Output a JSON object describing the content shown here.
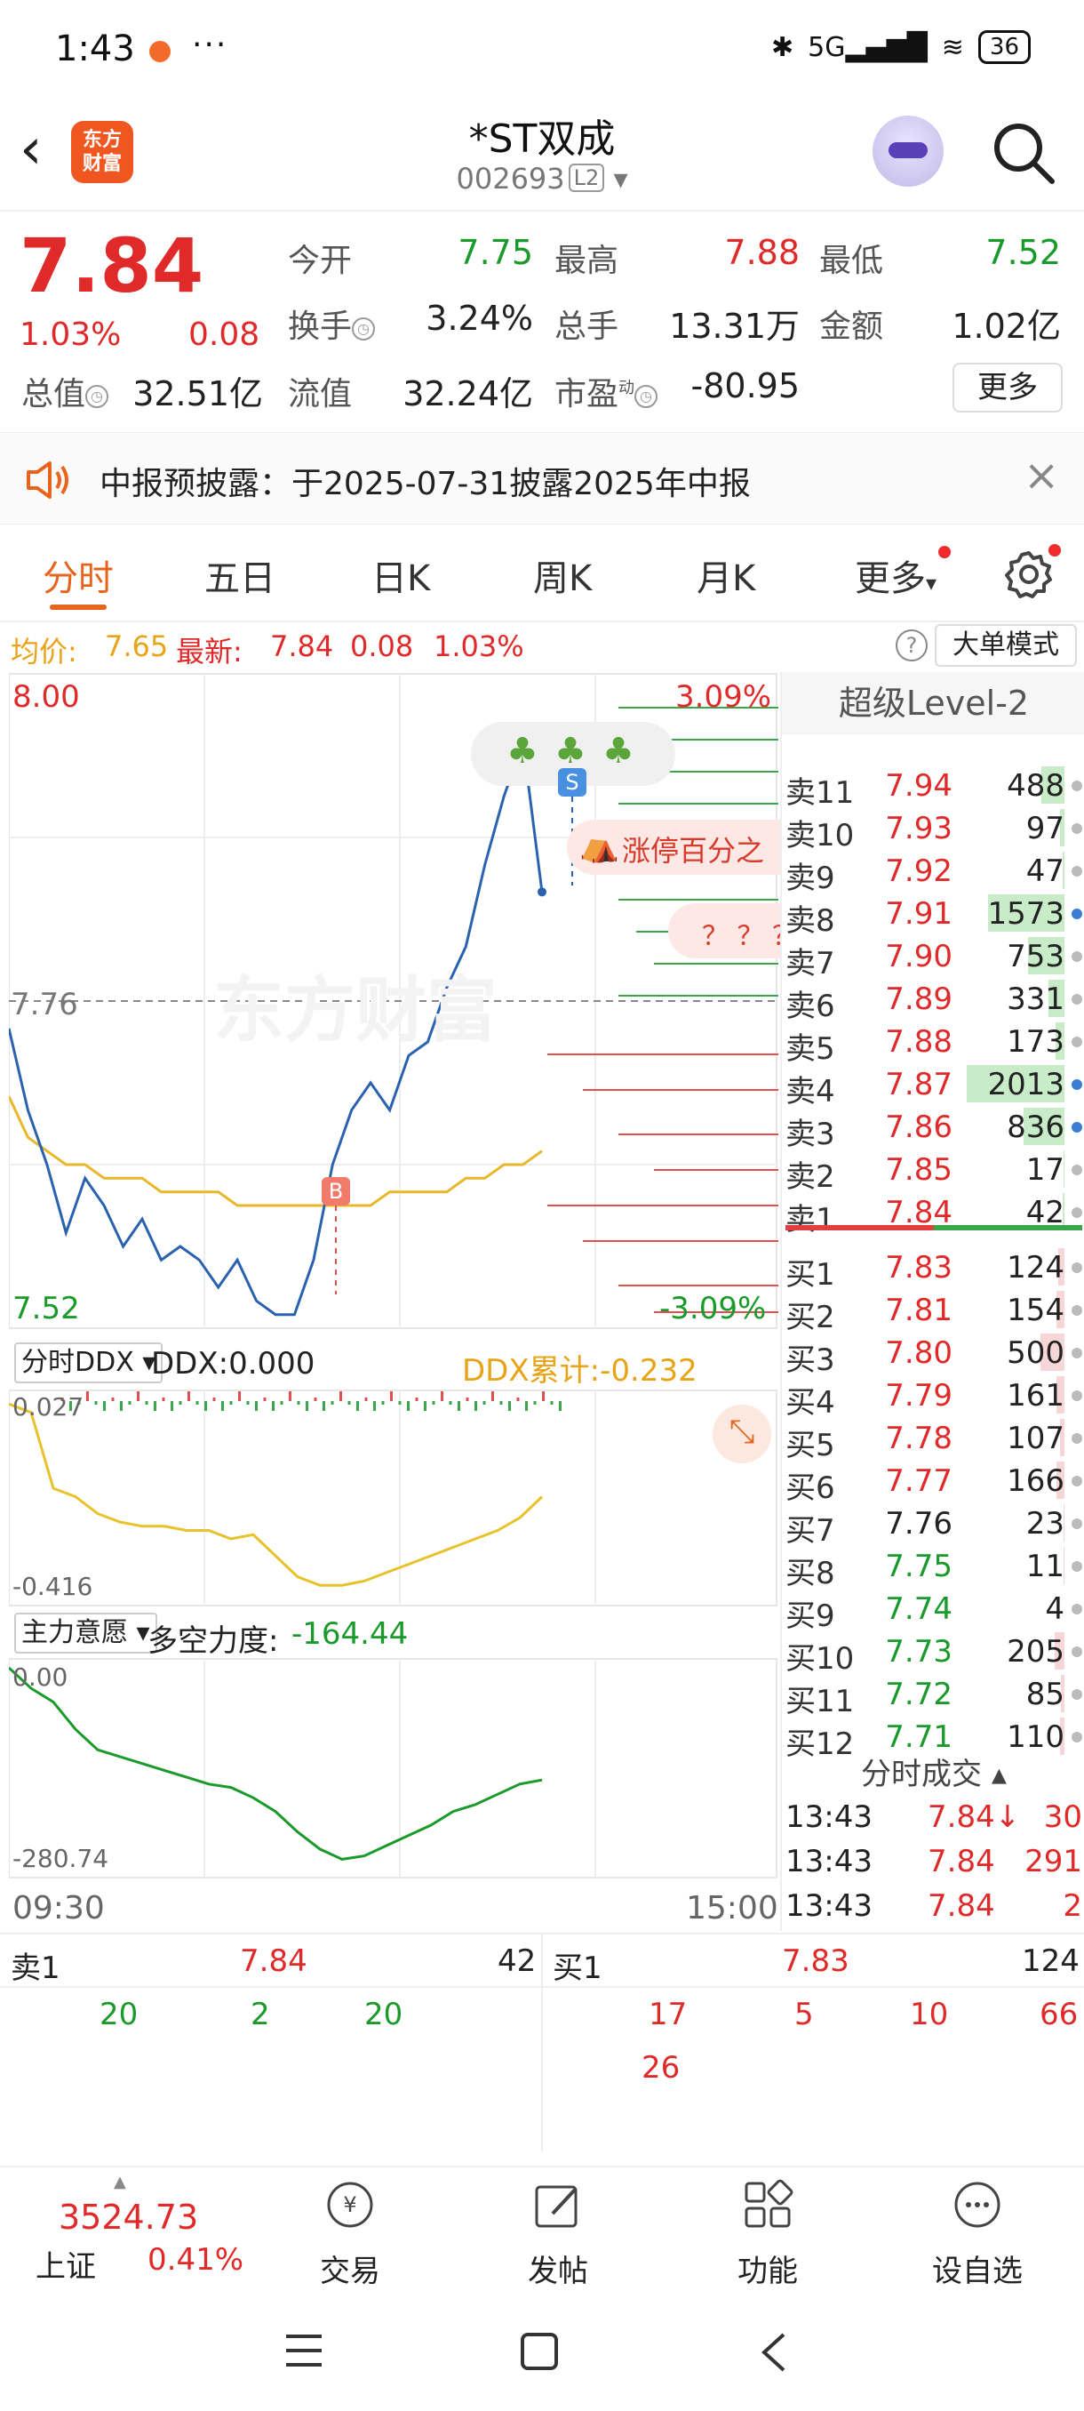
{
  "status_bar": {
    "time": "1:43",
    "more": "···",
    "network": "5G",
    "battery": "36"
  },
  "header": {
    "logo_line1": "东方",
    "logo_line2": "财富",
    "name": "*ST双成",
    "code": "002693",
    "level": "L2"
  },
  "quote": {
    "price": "7.84",
    "change_pct": "1.03%",
    "change_amt": "0.08",
    "open_label": "今开",
    "open": "7.75",
    "high_label": "最高",
    "high": "7.88",
    "low_label": "最低",
    "low": "7.52",
    "turnover_label": "换手",
    "turnover": "3.24%",
    "volume_label": "总手",
    "volume": "13.31万",
    "amount_label": "金额",
    "amount": "1.02亿",
    "mktcap_label": "总值",
    "mktcap": "32.51亿",
    "float_label": "流值",
    "float": "32.24亿",
    "pe_label": "市盈",
    "pe_sup": "动",
    "pe": "-80.95",
    "more_label": "更多"
  },
  "notice": {
    "text": "中报预披露：于2025-07-31披露2025年中报"
  },
  "tabs": [
    {
      "label": "分时"
    },
    {
      "label": "五日"
    },
    {
      "label": "日K"
    },
    {
      "label": "周K"
    },
    {
      "label": "月K"
    },
    {
      "label": "更多"
    }
  ],
  "info_row": {
    "avg_label": "均价:",
    "avg": "7.65",
    "latest_label": "最新:",
    "latest": "7.84",
    "chg": "0.08",
    "pct": "1.03%",
    "big_order": "大单模式",
    "help": "?"
  },
  "chart": {
    "y_top": "8.00",
    "y_mid": "7.76",
    "y_bot": "7.52",
    "pct_top": "3.09%",
    "pct_bot": "-3.09%",
    "watermark": "东方财富",
    "limit_bubble": "涨停百分之",
    "question_bubble": "？ ？ ？",
    "marker_s": "S",
    "marker_b": "B",
    "ddx_dropdown": "分时DDX",
    "ddx_label": "DDX:0.000",
    "ddx_cum": "DDX累计:-0.232",
    "ddx_top": "0.027",
    "ddx_bot": "-0.416",
    "zl_dropdown": "主力意愿",
    "zl_label": "多空力度:",
    "zl_val": "-164.44",
    "zl_top": "0.00",
    "zl_bot": "-280.74",
    "t_start": "09:30",
    "t_end": "15:00",
    "colors": {
      "price": "#2a62b0",
      "avg": "#e8b72a",
      "zl": "#1a9a2a"
    }
  },
  "chart_data": {
    "type": "line",
    "title": "",
    "x_range": [
      "09:30",
      "15:00"
    ],
    "ylim": [
      7.52,
      8.0
    ],
    "prev_close": 7.76,
    "series": [
      {
        "values": [
          7.74,
          7.68,
          7.64,
          7.59,
          7.63,
          7.61,
          7.58,
          7.6,
          7.57,
          7.58,
          7.57,
          7.55,
          7.57,
          7.54,
          7.53,
          7.53,
          7.57,
          7.64,
          7.68,
          7.7,
          7.68,
          7.72,
          7.73,
          7.77,
          7.8,
          7.86,
          7.91,
          7.95,
          7.84
        ]
      },
      {
        "values": [
          7.69,
          7.66,
          7.65,
          7.64,
          7.64,
          7.63,
          7.63,
          7.63,
          7.62,
          7.62,
          7.62,
          7.62,
          7.61,
          7.61,
          7.61,
          7.61,
          7.61,
          7.61,
          7.61,
          7.61,
          7.62,
          7.62,
          7.62,
          7.62,
          7.63,
          7.63,
          7.64,
          7.64,
          7.65
        ]
      }
    ]
  },
  "orderbook": {
    "title": "超级Level-2",
    "asks": [
      {
        "label": "卖11",
        "price": "7.94",
        "vol": "488",
        "share": 0.24
      },
      {
        "label": "卖10",
        "price": "7.93",
        "vol": "97",
        "share": 0.05
      },
      {
        "label": "卖9",
        "price": "7.92",
        "vol": "47",
        "share": 0.02
      },
      {
        "label": "卖8",
        "price": "7.91",
        "vol": "1573",
        "share": 0.78
      },
      {
        "label": "卖7",
        "price": "7.90",
        "vol": "753",
        "share": 0.37
      },
      {
        "label": "卖6",
        "price": "7.89",
        "vol": "331",
        "share": 0.16
      },
      {
        "label": "卖5",
        "price": "7.88",
        "vol": "173",
        "share": 0.09
      },
      {
        "label": "卖4",
        "price": "7.87",
        "vol": "2013",
        "share": 1.0
      },
      {
        "label": "卖3",
        "price": "7.86",
        "vol": "836",
        "share": 0.42
      },
      {
        "label": "卖2",
        "price": "7.85",
        "vol": "17",
        "share": 0.01
      },
      {
        "label": "卖1",
        "price": "7.84",
        "vol": "42",
        "share": 0.02
      }
    ],
    "bids": [
      {
        "label": "买1",
        "price": "7.83",
        "vol": "124",
        "share": 0.06
      },
      {
        "label": "买2",
        "price": "7.81",
        "vol": "154",
        "share": 0.08
      },
      {
        "label": "买3",
        "price": "7.80",
        "vol": "500",
        "share": 0.25
      },
      {
        "label": "买4",
        "price": "7.79",
        "vol": "161",
        "share": 0.08
      },
      {
        "label": "买5",
        "price": "7.78",
        "vol": "107",
        "share": 0.05
      },
      {
        "label": "买6",
        "price": "7.77",
        "vol": "166",
        "share": 0.08
      },
      {
        "label": "买7",
        "price": "7.76",
        "vol": "23",
        "share": 0.01
      },
      {
        "label": "买8",
        "price": "7.75",
        "vol": "11",
        "share": 0.01
      },
      {
        "label": "买9",
        "price": "7.74",
        "vol": "4",
        "share": 0.0
      },
      {
        "label": "买10",
        "price": "7.73",
        "vol": "205",
        "share": 0.1
      },
      {
        "label": "买11",
        "price": "7.72",
        "vol": "85",
        "share": 0.04
      },
      {
        "label": "买12",
        "price": "7.71",
        "vol": "110",
        "share": 0.05
      }
    ],
    "ticks_title": "分时成交",
    "ticks": [
      {
        "time": "13:43",
        "price": "7.84↓",
        "vol": "30"
      },
      {
        "time": "13:43",
        "price": "7.84",
        "vol": "291"
      },
      {
        "time": "13:43",
        "price": "7.84",
        "vol": "2"
      }
    ]
  },
  "queue": {
    "sell_label": "卖1",
    "sell_price": "7.84",
    "sell_total": "42",
    "sell_orders": [
      "20",
      "2",
      "20"
    ],
    "buy_label": "买1",
    "buy_price": "7.83",
    "buy_total": "124",
    "buy_orders": [
      "17",
      "5",
      "10",
      "66",
      "26"
    ]
  },
  "toolbar": {
    "index_value": "3524.73",
    "index_name": "上证",
    "index_pct": "0.41%",
    "trade": "交易",
    "post": "发帖",
    "func": "功能",
    "watch": "设自选"
  }
}
